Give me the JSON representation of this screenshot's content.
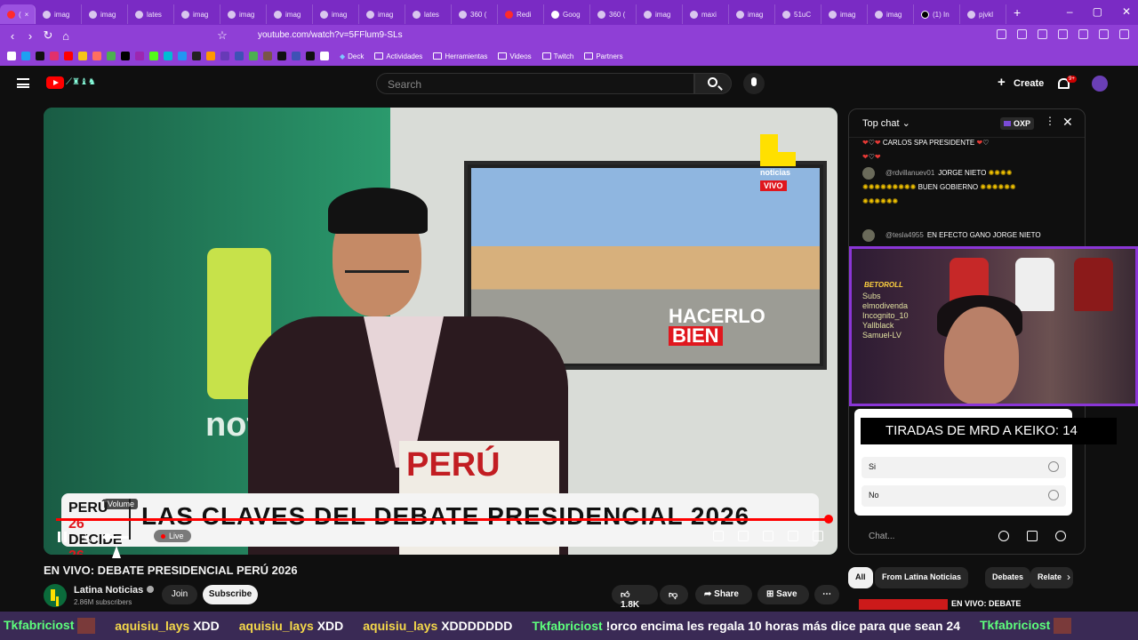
{
  "browser": {
    "tabs": [
      {
        "label": "(",
        "icon": "youtube-icon"
      },
      {
        "label": "imag",
        "icon": "globe-icon"
      },
      {
        "label": "imag",
        "icon": "globe-icon"
      },
      {
        "label": "lates",
        "icon": "globe-icon"
      },
      {
        "label": "imag",
        "icon": "globe-icon"
      },
      {
        "label": "imag",
        "icon": "globe-icon"
      },
      {
        "label": "imag",
        "icon": "globe-icon"
      },
      {
        "label": "imag",
        "icon": "globe-icon"
      },
      {
        "label": "imag",
        "icon": "globe-icon"
      },
      {
        "label": "lates",
        "icon": "globe-icon"
      },
      {
        "label": "360 (",
        "icon": "globe-icon"
      },
      {
        "label": "Redi",
        "icon": "reddit-icon"
      },
      {
        "label": "Goog",
        "icon": "google-icon"
      },
      {
        "label": "360 (",
        "icon": "globe-icon"
      },
      {
        "label": "imag",
        "icon": "globe-icon"
      },
      {
        "label": "maxi",
        "icon": "globe-icon"
      },
      {
        "label": "imag",
        "icon": "globe-icon"
      },
      {
        "label": "51uC",
        "icon": "globe-icon"
      },
      {
        "label": "imag",
        "icon": "globe-icon"
      },
      {
        "label": "imag",
        "icon": "globe-icon"
      },
      {
        "label": "(1) In",
        "icon": "x-icon"
      },
      {
        "label": "pjvkl",
        "icon": "globe-icon"
      }
    ],
    "url": "youtube.com/watch?v=5FFlum9-SLs",
    "bookmarks": [
      "Deck",
      "Actividades",
      "Herramientas",
      "Videos",
      "Twitch",
      "Partners"
    ],
    "accent": "#7a2bc4"
  },
  "youtube": {
    "search_placeholder": "Search",
    "create_label": "Create",
    "notification_count": "9+"
  },
  "video": {
    "badge_noticias": "noticias",
    "badge_vivo": "VIVO",
    "tv_text_line1": "HACERLO",
    "tv_text_line2": "BIEN",
    "lower_third_left": "PERÚ",
    "lower_third_left2": "DECIDE",
    "lower_third_year": "26",
    "lower_third_title": "LAS CLAVES DEL DEBATE PRESIDENCIAL 2026",
    "live_label": "Live",
    "volume_tooltip": "Volume",
    "box_text": "PERÚ",
    "wall_text": "not",
    "title": "EN VIVO: DEBATE PRESIDENCIAL PERÚ 2026",
    "progress": 1.0
  },
  "channel": {
    "name": "Latina Noticias",
    "subscribers": "2.86M subscribers",
    "join_label": "Join",
    "subscribe_label": "Subscribe",
    "likes": "1.8K",
    "share_label": "Share",
    "save_label": "Save"
  },
  "chat": {
    "header": "Top chat",
    "oxp": "OXP",
    "messages": [
      {
        "author": "",
        "text": "CARLOS SPA PRESIDENTE"
      },
      {
        "author": "@rdvillanuev01",
        "text": "JORGE NIETO"
      },
      {
        "author": "",
        "text": "BUEN GOBIERNO"
      },
      {
        "author": "@tesla4955",
        "text": "EN EFECTO GANO JORGE NIETO"
      }
    ],
    "poll_options": [
      "Si",
      "No"
    ],
    "input_placeholder": "Chat..."
  },
  "stream_overlay": {
    "bet_logo": "BETOROLL",
    "subs_title": "Subs",
    "subs": [
      "elmodivenda",
      "Incognito_10",
      "Yallblack",
      "Samuel-LV"
    ],
    "counter": "TIRADAS DE MRD A KEIKO: 14"
  },
  "filters": [
    "All",
    "From Latina Noticias",
    "Debates",
    "Relate"
  ],
  "related_title": "EN VIVO: DEBATE",
  "ticker": [
    {
      "user": "Tkfabriciost",
      "text": "",
      "color": "green"
    },
    {
      "user": "aquisiu_lays",
      "text": "XDD",
      "color": "yellow"
    },
    {
      "user": "aquisiu_lays",
      "text": "XDD",
      "color": "yellow"
    },
    {
      "user": "aquisiu_lays",
      "text": "XDDDDDDD",
      "color": "yellow"
    },
    {
      "user": "Tkfabriciost",
      "text": "!orco encima les regala 10 horas más dice para que sean 24",
      "color": "green"
    },
    {
      "user": "Tkfabriciost",
      "text": "",
      "color": "green"
    }
  ]
}
